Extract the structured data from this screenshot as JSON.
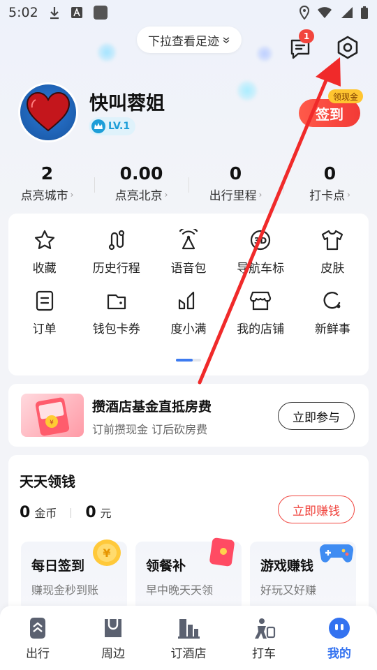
{
  "status_bar": {
    "time": "5:02"
  },
  "header": {
    "pull_tip": "下拉查看足迹",
    "message_badge": "1"
  },
  "profile": {
    "username": "快叫蓉姐",
    "level": "LV.1",
    "checkin_label": "签到",
    "checkin_tag": "领现金"
  },
  "stats": [
    {
      "value": "2",
      "label": "点亮城市"
    },
    {
      "value": "0.00",
      "label": "点亮北京"
    },
    {
      "value": "0",
      "label": "出行里程"
    },
    {
      "value": "0",
      "label": "打卡点"
    }
  ],
  "grid": [
    {
      "label": "收藏",
      "icon": "star-icon"
    },
    {
      "label": "历史行程",
      "icon": "route-icon"
    },
    {
      "label": "语音包",
      "icon": "voice-pack-icon"
    },
    {
      "label": "导航车标",
      "icon": "car-marker-3d-icon"
    },
    {
      "label": "皮肤",
      "icon": "shirt-icon"
    },
    {
      "label": "订单",
      "icon": "order-icon"
    },
    {
      "label": "钱包卡券",
      "icon": "wallet-icon"
    },
    {
      "label": "度小满",
      "icon": "duxiaoman-icon"
    },
    {
      "label": "我的店铺",
      "icon": "shop-icon"
    },
    {
      "label": "新鲜事",
      "icon": "news-icon"
    }
  ],
  "promo": {
    "title": "攒酒店基金直抵房费",
    "subtitle": "订前攒现金 订后砍房费",
    "button": "立即参与"
  },
  "earn": {
    "title": "天天领钱",
    "coins": "0",
    "coins_unit": "金币",
    "cash": "0",
    "cash_unit": "元",
    "button": "立即赚钱",
    "tasks": [
      {
        "title": "每日签到",
        "subtitle": "赚现金秒到账",
        "icon": "coin-icon"
      },
      {
        "title": "领餐补",
        "subtitle": "早中晚天天领",
        "icon": "red-packet-icon"
      },
      {
        "title": "游戏赚钱",
        "subtitle": "好玩又好赚",
        "icon": "gamepad-icon"
      }
    ]
  },
  "tabs": [
    {
      "label": "出行",
      "icon": "travel-icon",
      "active": false
    },
    {
      "label": "周边",
      "icon": "nearby-icon",
      "active": false
    },
    {
      "label": "订酒店",
      "icon": "hotel-icon",
      "active": false
    },
    {
      "label": "打车",
      "icon": "taxi-icon",
      "active": false
    },
    {
      "label": "我的",
      "icon": "mine-icon",
      "active": true
    }
  ],
  "colors": {
    "accent": "#3372f0",
    "checkin": "#f23a36",
    "annotation_arrow": "#f02a2a"
  }
}
